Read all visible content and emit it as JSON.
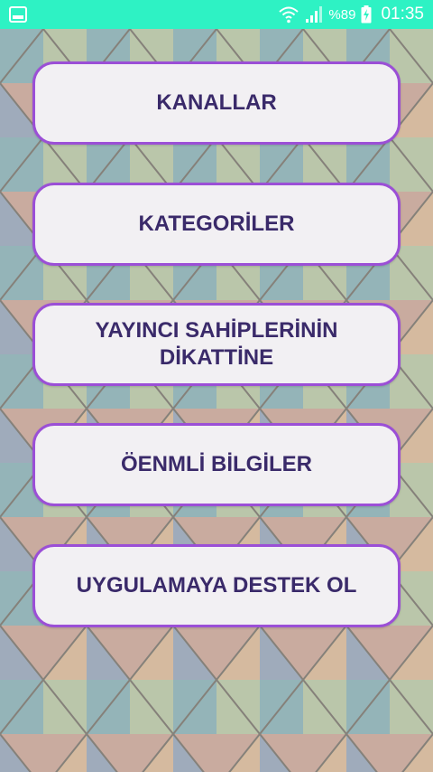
{
  "status_bar": {
    "battery_text": "%89",
    "time": "01:35",
    "bg_color": "#2ef2c4",
    "icons": [
      "gallery-icon",
      "wifi-icon",
      "signal-icon",
      "battery-charging-icon"
    ]
  },
  "menu": {
    "items": [
      {
        "label": "KANALLAR"
      },
      {
        "label": "KATEGORİLER"
      },
      {
        "label": "YAYINCI SAHİPLERİNİN DİKATTİNE"
      },
      {
        "label": "ÖENMLİ BİLGİLER"
      },
      {
        "label": "UYGULAMAYA DESTEK OL"
      }
    ],
    "button_border_color": "#9b4fd6",
    "button_text_color": "#3a2a6a"
  }
}
